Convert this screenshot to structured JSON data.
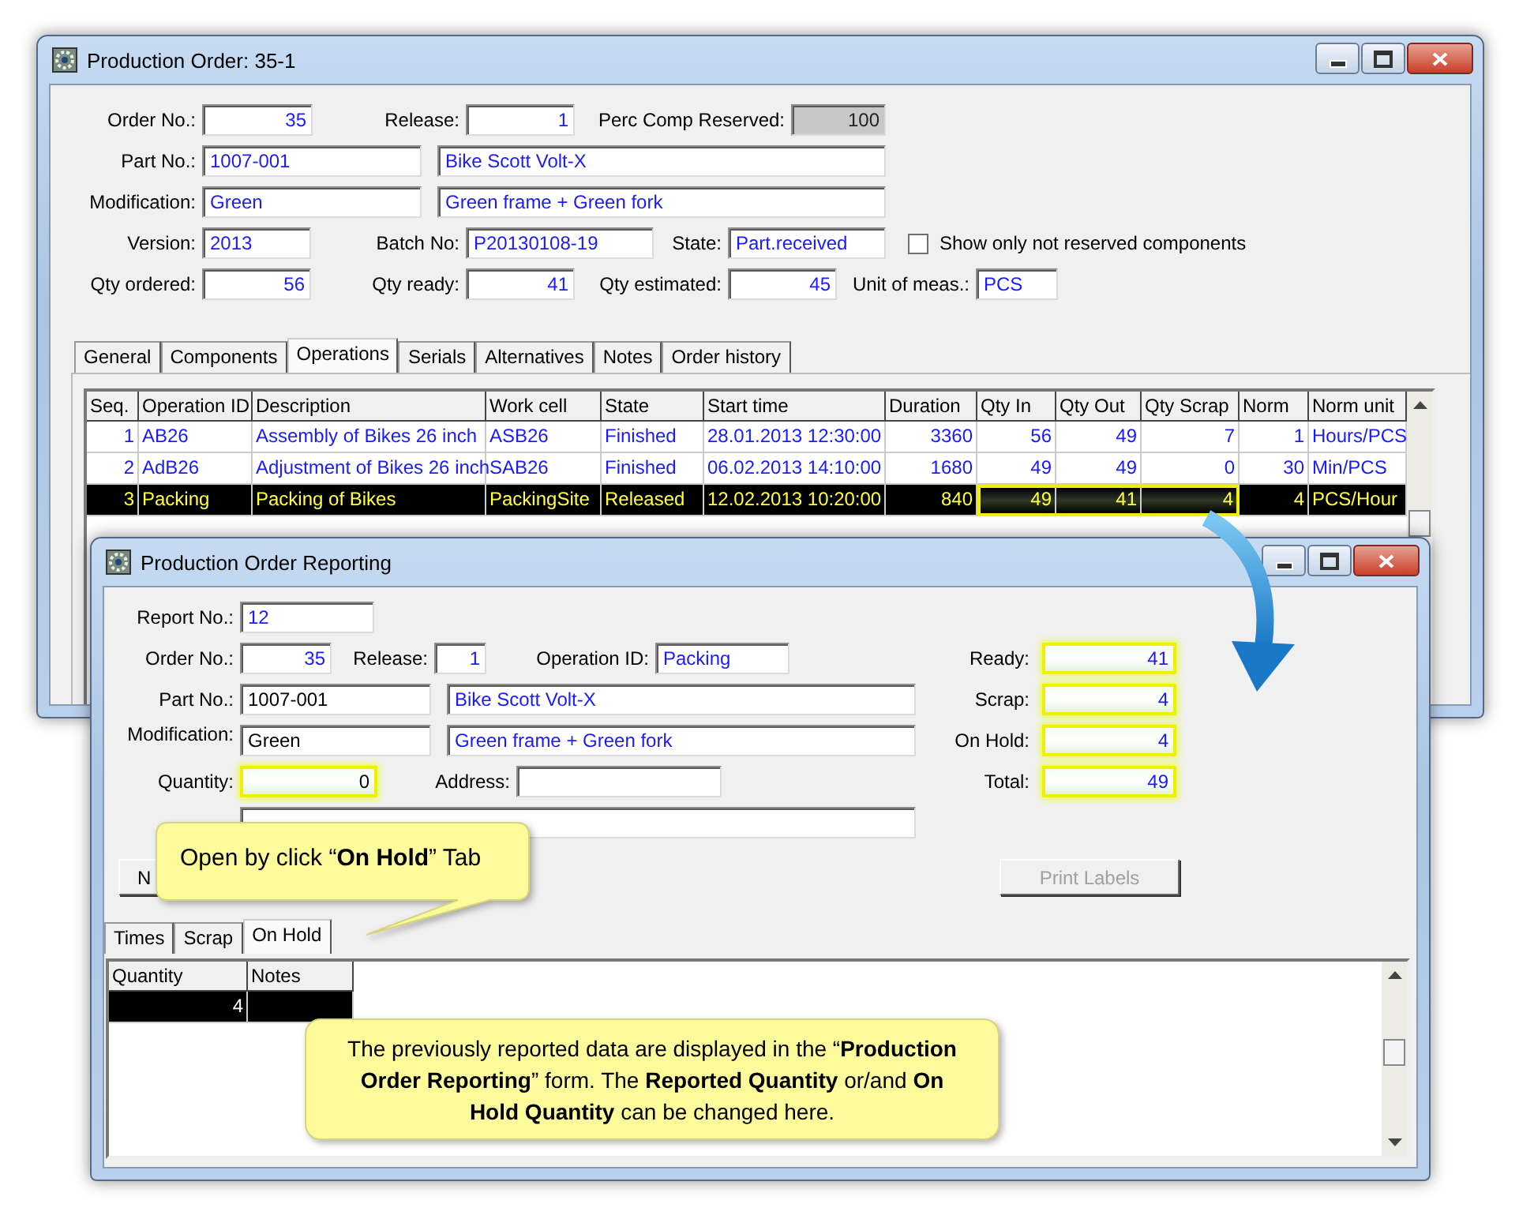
{
  "production_order_window": {
    "title": "Production Order: 35-1",
    "order_no": {
      "label": "Order No.:",
      "value": "35"
    },
    "release": {
      "label": "Release:",
      "value": "1"
    },
    "perc_comp_reserved": {
      "label": "Perc Comp Reserved:",
      "value": "100",
      "disabled": true
    },
    "part_no": {
      "label": "Part No.:",
      "value": "1007-001",
      "description": "Bike Scott Volt-X"
    },
    "modification": {
      "label": "Modification:",
      "value": "Green",
      "description": "Green frame + Green fork"
    },
    "version": {
      "label": "Version:",
      "value": "2013"
    },
    "batch_no": {
      "label": "Batch No:",
      "value": "P20130108-19"
    },
    "state": {
      "label": "State:",
      "value": "Part.received"
    },
    "show_only_not_reserved": {
      "label": "Show only not reserved components",
      "checked": false
    },
    "qty_ordered": {
      "label": "Qty ordered:",
      "value": "56"
    },
    "qty_ready": {
      "label": "Qty ready:",
      "value": "41"
    },
    "qty_estimated": {
      "label": "Qty estimated:",
      "value": "45"
    },
    "unit_of_meas": {
      "label": "Unit of meas.:",
      "value": "PCS"
    },
    "tabs": [
      {
        "label": "General",
        "selected": false
      },
      {
        "label": "Components",
        "selected": false
      },
      {
        "label": "Operations",
        "selected": true
      },
      {
        "label": "Serials",
        "selected": false
      },
      {
        "label": "Alternatives",
        "selected": false
      },
      {
        "label": "Notes",
        "selected": false
      },
      {
        "label": "Order history",
        "selected": false
      }
    ],
    "operations_table": {
      "columns": [
        {
          "label": "Seq.",
          "kind": "num",
          "highlighted": false
        },
        {
          "label": "Operation ID",
          "kind": "text",
          "highlighted": false
        },
        {
          "label": "Description",
          "kind": "text",
          "highlighted": false
        },
        {
          "label": "Work cell",
          "kind": "text",
          "highlighted": false
        },
        {
          "label": "State",
          "kind": "text",
          "highlighted": false
        },
        {
          "label": "Start time",
          "kind": "text",
          "highlighted": false
        },
        {
          "label": "Duration",
          "kind": "num",
          "highlighted": false
        },
        {
          "label": "Qty In",
          "kind": "num",
          "highlighted": true
        },
        {
          "label": "Qty Out",
          "kind": "num",
          "highlighted": true
        },
        {
          "label": "Qty Scrap",
          "kind": "num",
          "highlighted": true
        },
        {
          "label": "Norm",
          "kind": "num",
          "highlighted": false
        },
        {
          "label": "Norm unit",
          "kind": "text",
          "highlighted": false
        }
      ],
      "rows": [
        {
          "selected": false,
          "highlighted": false,
          "cells": [
            "1",
            "AB26",
            "Assembly of Bikes 26 inch",
            "ASB26",
            "Finished",
            "28.01.2013 12:30:00",
            "3360",
            "56",
            "49",
            "7",
            "1",
            "Hours/PCS"
          ]
        },
        {
          "selected": false,
          "highlighted": false,
          "cells": [
            "2",
            "AdB26",
            "Adjustment of Bikes 26 inch",
            "SAB26",
            "Finished",
            "06.02.2013 14:10:00",
            "1680",
            "49",
            "49",
            "0",
            "30",
            "Min/PCS"
          ]
        },
        {
          "selected": true,
          "highlighted": true,
          "cells": [
            "3",
            "Packing",
            "Packing of Bikes",
            "PackingSite",
            "Released",
            "12.02.2013 10:20:00",
            "840",
            "49",
            "41",
            "4",
            "4",
            "PCS/Hour"
          ]
        }
      ]
    }
  },
  "reporting_window": {
    "title": "Production Order Reporting",
    "report_no": {
      "label": "Report No.:",
      "value": "12",
      "editable": false,
      "highlighted": false
    },
    "order_no": {
      "label": "Order No.:",
      "value": "35",
      "editable": false,
      "highlighted": false
    },
    "release": {
      "label": "Release:",
      "value": "1",
      "editable": false,
      "highlighted": false
    },
    "operation_id": {
      "label": "Operation ID:",
      "value": "Packing",
      "editable": false,
      "highlighted": false
    },
    "part_no": {
      "label": "Part No.:",
      "value": "1007-001",
      "editable": true,
      "highlighted": false
    },
    "part_description": {
      "value": "Bike Scott Volt-X",
      "editable": false,
      "highlighted": false
    },
    "modification": {
      "label": "Modification:",
      "value": "Green",
      "editable": true,
      "highlighted": false
    },
    "modification_description": {
      "value": "Green frame + Green fork",
      "editable": false,
      "highlighted": false
    },
    "quantity": {
      "label": "Quantity:",
      "value": "0",
      "editable": true,
      "highlighted": true
    },
    "address": {
      "label": "Address:"
    },
    "ready": {
      "label": "Ready:",
      "value": "41",
      "editable": false,
      "highlighted": true
    },
    "scrap": {
      "label": "Scrap:",
      "value": "4",
      "editable": false,
      "highlighted": true
    },
    "on_hold": {
      "label": "On Hold:",
      "value": "4",
      "editable": false,
      "highlighted": true
    },
    "total": {
      "label": "Total:",
      "value": "49",
      "editable": false,
      "highlighted": true
    },
    "buttons": [
      {
        "label": "N",
        "disabled": false
      },
      {
        "label": "Print Labels",
        "disabled": true
      }
    ],
    "tabs": [
      {
        "label": "Times",
        "selected": false
      },
      {
        "label": "Scrap",
        "selected": false
      },
      {
        "label": "On Hold",
        "selected": true
      }
    ],
    "on_hold_table": {
      "columns": [
        {
          "label": "Quantity",
          "kind": "num"
        },
        {
          "label": "Notes",
          "kind": "text"
        }
      ],
      "rows": [
        {
          "selected": true,
          "cells": [
            "4"
          ]
        }
      ]
    }
  },
  "callouts": [
    {
      "text": "Open by click “**On Hold**” Tab"
    },
    {
      "text": "The previously reported data are displayed in the “**Production  Order Reporting**” form. The **Reported Quantity** or/and **On Hold Quantity** can be changed here."
    }
  ]
}
